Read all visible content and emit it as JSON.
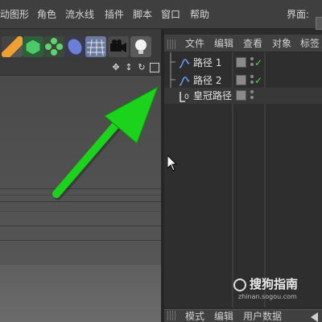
{
  "menubar": {
    "items": [
      "动图形",
      "角色",
      "流水线",
      "插件",
      "脚本",
      "窗口",
      "帮助"
    ],
    "layout_label": "界面:"
  },
  "toolbar": {
    "icons": [
      "pen-tool-icon",
      "cube-icon",
      "cloner-icon",
      "deformer-icon",
      "floor-grid-icon",
      "camera-icon",
      "light-bulb-icon"
    ]
  },
  "viewport": {
    "controls": [
      "move-icon",
      "zoom-icon",
      "rotate-icon",
      "maximize-icon"
    ]
  },
  "object_manager": {
    "menu": [
      "文件",
      "编辑",
      "查看",
      "对象",
      "标签"
    ],
    "rows": [
      {
        "label": "路径 1",
        "icon": "spline-icon",
        "checked": true
      },
      {
        "label": "路径 2",
        "icon": "spline-icon",
        "checked": true
      },
      {
        "label": "皇冠路径",
        "icon": "loft-icon",
        "checked": false
      }
    ]
  },
  "attributes": {
    "menu": [
      "模式",
      "编辑",
      "用户数据"
    ]
  },
  "watermark": {
    "text": "搜狗指南",
    "url": "zhinan.sogou.com"
  },
  "colors": {
    "annotation_arrow": "#1bd31b",
    "check": "#5fd35f",
    "panel_bg": "#2e2e2e"
  }
}
